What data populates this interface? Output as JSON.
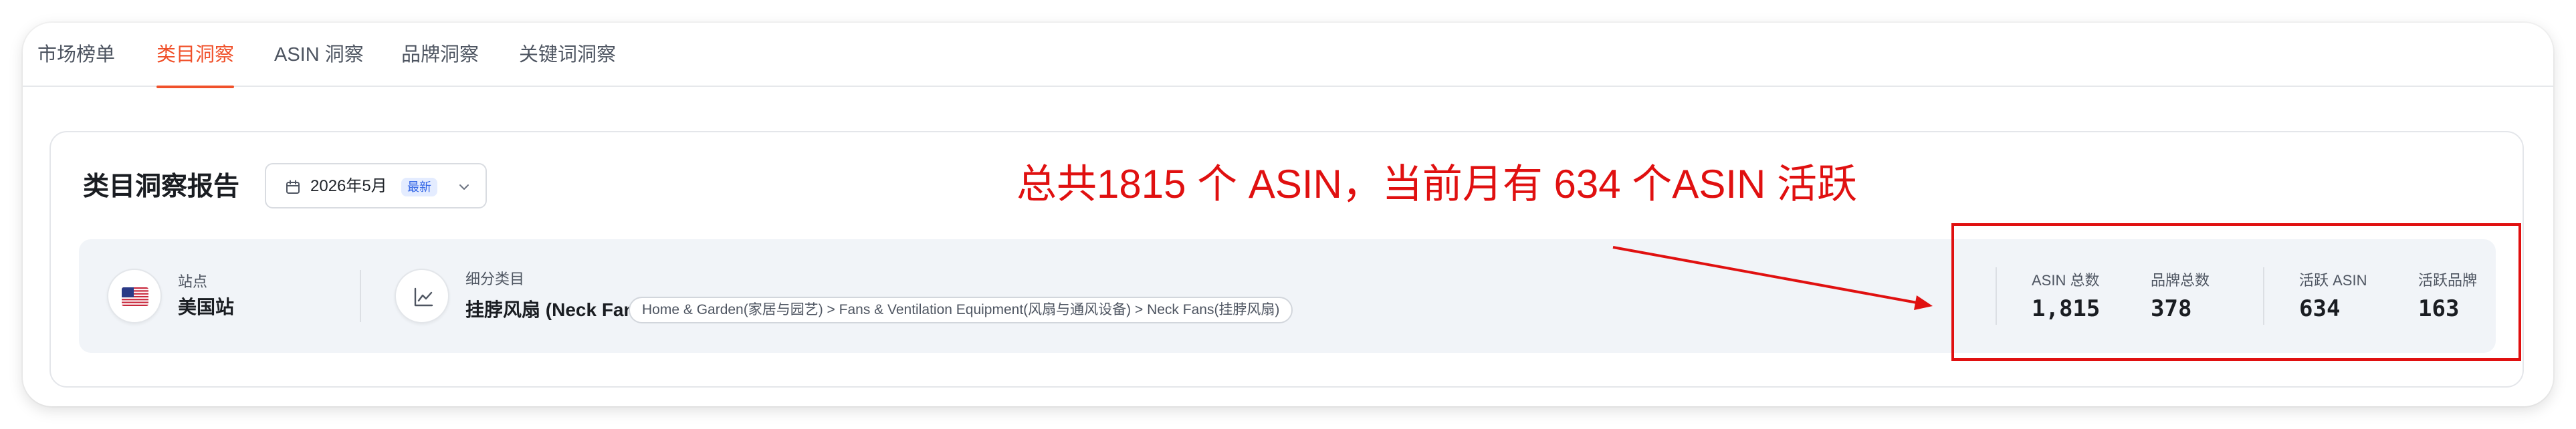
{
  "tabs": [
    {
      "label": "市场榜单",
      "active": false
    },
    {
      "label": "类目洞察",
      "active": true
    },
    {
      "label": "ASIN 洞察",
      "active": false
    },
    {
      "label": "品牌洞察",
      "active": false
    },
    {
      "label": "关键词洞察",
      "active": false
    }
  ],
  "report": {
    "title": "类目洞察报告",
    "date_label": "2026年5月",
    "date_badge": "最新"
  },
  "site": {
    "label": "站点",
    "value": "美国站"
  },
  "category": {
    "label": "细分类目",
    "value": "挂脖风扇 (Neck Fans)",
    "breadcrumb": "Home & Garden(家居与园艺) > Fans & Ventilation Equipment(风扇与通风设备) > Neck Fans(挂脖风扇)"
  },
  "stats": [
    {
      "label": "ASIN 总数",
      "value": "1,815"
    },
    {
      "label": "品牌总数",
      "value": "378"
    },
    {
      "label": "活跃 ASIN",
      "value": "634"
    },
    {
      "label": "活跃品牌",
      "value": "163"
    }
  ],
  "annotation": {
    "text": "总共1815 个 ASIN，当前月有 634 个ASIN 活跃"
  },
  "colors": {
    "accent": "#f0512b",
    "annotation": "#e01010",
    "badge_bg": "#e4ecff",
    "badge_text": "#3366e6"
  }
}
